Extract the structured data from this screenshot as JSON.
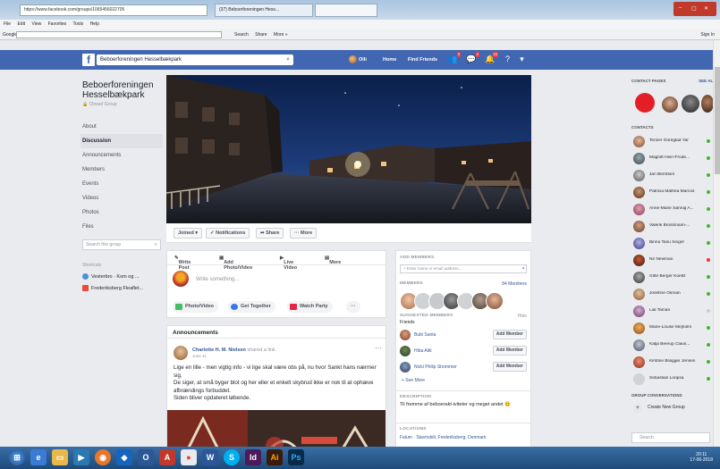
{
  "browser": {
    "url": "https://www.facebook.com/groups/1065456022705",
    "tab1": "(37) Beboerforeningen Hess...",
    "tab2": "",
    "menu": [
      "File",
      "Edit",
      "View",
      "Favorites",
      "Tools",
      "Help"
    ],
    "google_label": "Google",
    "toolbar": [
      "Search",
      "Share",
      "More »"
    ],
    "sign_in": "Sign In"
  },
  "fb_header": {
    "search_value": "Beboerforeningen Hesselbækpark",
    "user": "Olli",
    "links": [
      "Home",
      "Find Friends"
    ],
    "badges": [
      "9",
      "2",
      "20"
    ]
  },
  "group": {
    "title_line1": "Beboerforeningen",
    "title_line2": "Hesselbækpark",
    "type": "Closed Group",
    "nav": [
      "About",
      "Discussion",
      "Announcements",
      "Members",
      "Events",
      "Videos",
      "Photos",
      "Files"
    ],
    "active_nav": "Discussion",
    "search_placeholder": "Search this group",
    "shortcuts_heading": "Shortcuts",
    "shortcuts": [
      "Vesterbro · Kom og ...",
      "Frederiksberg Fleaflet..."
    ]
  },
  "actionbar": {
    "joined": "Joined ▾",
    "notifications": "✓ Notifications",
    "share": "➦ Share",
    "more": "··· More"
  },
  "composer": {
    "tabs": [
      "Write Post",
      "Add Photo/Video",
      "Live Video",
      "More"
    ],
    "placeholder": "Write something...",
    "actions": [
      "Photo/Video",
      "Get Together",
      "Watch Party",
      "···"
    ]
  },
  "announcements": {
    "heading": "Announcements",
    "author": "Charlotte H. M. Nielsen",
    "shared": "shared a link.",
    "date": "June 11",
    "text": [
      "Lige en lille - men vigtig info - vi lige skal være obs på, nu hvor Sankt hans nærmer sig.",
      "De siger, at små byger blot og her eller et enkelt skybrud ikke er nok til at ophæve afbrændings forbuddet.",
      "Siden bliver opdateret løbende."
    ]
  },
  "members_panel": {
    "add_heading": "ADD MEMBERS",
    "add_placeholder": "+ Enter name or email address...",
    "members_heading": "MEMBERS",
    "members_count": "84 Members",
    "suggested_heading": "SUGGESTED MEMBERS",
    "hide": "Hide",
    "friends_label": "Friends",
    "suggested": [
      {
        "name": "Bubi Santa",
        "button": "Add Member"
      },
      {
        "name": "Hiba Aliti",
        "button": "Add Member"
      },
      {
        "name": "Nicki Philip Strommer",
        "button": "Add Member"
      }
    ],
    "see_more": "+ See More",
    "description_heading": "DESCRIPTION",
    "description": "Til fremme af beboerakt-iviteter og meget andet 😊",
    "locations_heading": "LOCATIONS",
    "location": "Falum · Stavnsbill, Frederiksberg, Denmark"
  },
  "sidebar": {
    "contact_pages": "CONTACT PAGES",
    "see_all": "SEE ALL",
    "contacts_heading": "CONTACTS",
    "contacts": [
      "Tenzer Goreglad Yar",
      "Magnitt Hein-Frode...",
      "Jan Berntsen",
      "Patricia Mathea Marcos",
      "Anne-Marie Sønnig A...",
      "Valerik Brossmann-...",
      "Binnu Tanu Singer",
      "Nir Newman",
      "Gitte Berger Koeltz",
      "Josefine Osman",
      "Lial Tamari",
      "Marie-Louise Mejholm",
      "Katja Beerup Claus...",
      "Kirstine Brøgger Jensen",
      "Sebastian Lorqisa"
    ],
    "group_conversations": "GROUP CONVERSATIONS",
    "create_group": "Create New Group",
    "search_placeholder": "Search"
  },
  "taskbar": {
    "clock": "20:11",
    "date": "17-06-2018"
  }
}
